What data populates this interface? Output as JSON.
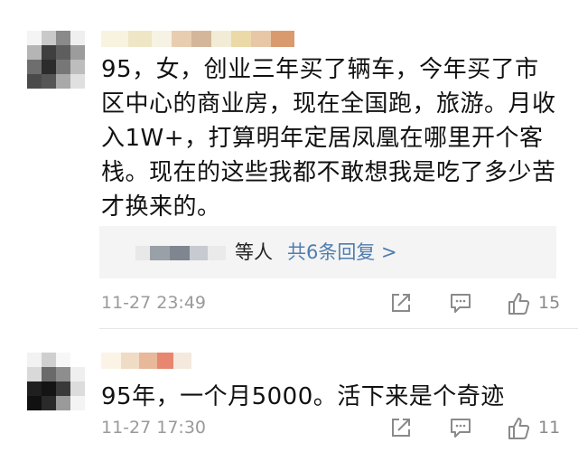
{
  "comments": [
    {
      "text": "95，女，创业三年买了辆车，今年买了市区中心的商业房，现在全国跑，旅游。月收入1W+，打算明年定居凤凰在哪里开个客栈。现在的这些我都不敢想我是吃了多少苦才换来的。",
      "replies": {
        "who_suffix": "等人",
        "more_label": "共6条回复 >"
      },
      "time": "11-27 23:49",
      "likes": "15"
    },
    {
      "text": "95年，一个月5000。活下来是个奇迹",
      "time": "11-27 17:30",
      "likes": "11"
    }
  ],
  "icons": [
    "avatar",
    "repost-icon",
    "comment-icon",
    "like-icon"
  ],
  "colors": {
    "link": "#507daf",
    "meta": "#9a9a9a",
    "reply_bg": "#f4f4f4"
  }
}
